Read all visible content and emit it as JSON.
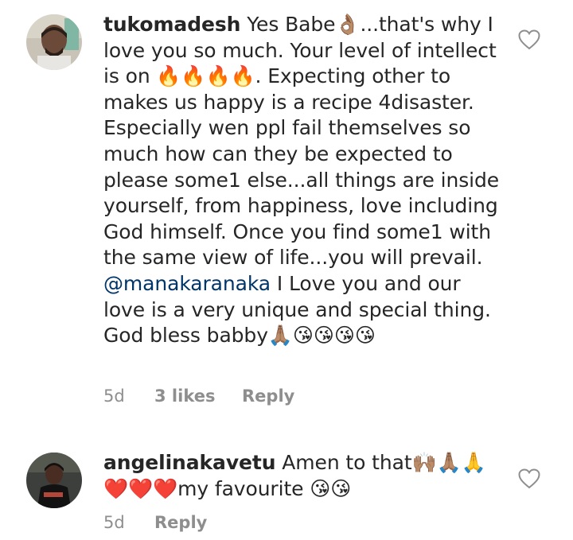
{
  "comments": [
    {
      "username": "tukomadesh",
      "text_before_mention": "Yes Babe👌🏽...that's why I love you so much. Your level of intellect is on 🔥🔥🔥🔥. Expecting other to makes us happy is a recipe 4disaster. Especially wen ppl fail themselves so much how can they be expected to please some1 else...all things are inside yourself, from happiness, love including God himself. Once you find some1 with the same view of life...you will prevail.",
      "mention": "@manakaranaka",
      "text_after_mention": "I Love you and our love is a very unique and special thing. God bless babby🙏🏽😘😘😘😘",
      "time": "5d",
      "likes": "3 likes",
      "reply_label": "Reply"
    },
    {
      "username": "angelinakavetu",
      "text": "Amen to that🙌🏽🙏🏽🙏 ❤️❤️❤️my favourite 😘😘",
      "time": "5d",
      "reply_label": "Reply"
    }
  ],
  "icons": {
    "like": "heart-outline-icon"
  },
  "colors": {
    "text": "#262626",
    "meta": "#8e8e8e",
    "mention": "#003569"
  }
}
